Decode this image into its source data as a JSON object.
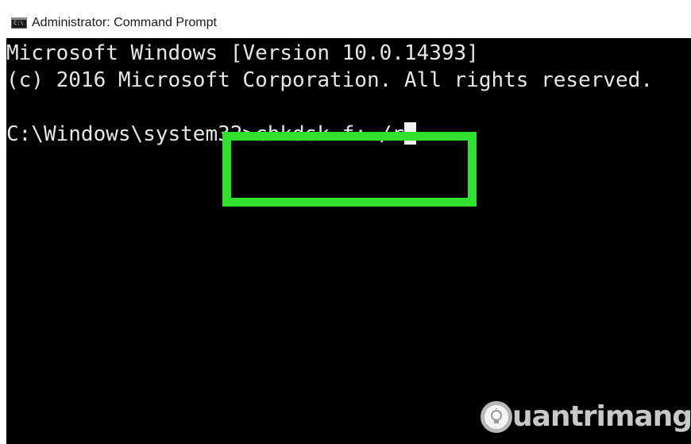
{
  "window": {
    "title": "Administrator: Command Prompt",
    "icon": "cmd-icon"
  },
  "console": {
    "lines": [
      "Microsoft Windows [Version 10.0.14393]",
      "(c) 2016 Microsoft Corporation. All rights reserved."
    ],
    "prompt": "C:\\Windows\\system32>",
    "command": "chkdsk f: /r"
  },
  "highlight_color": "#2fe02f",
  "watermark": {
    "text": "uantrimang",
    "icon": "lightbulb-icon"
  }
}
